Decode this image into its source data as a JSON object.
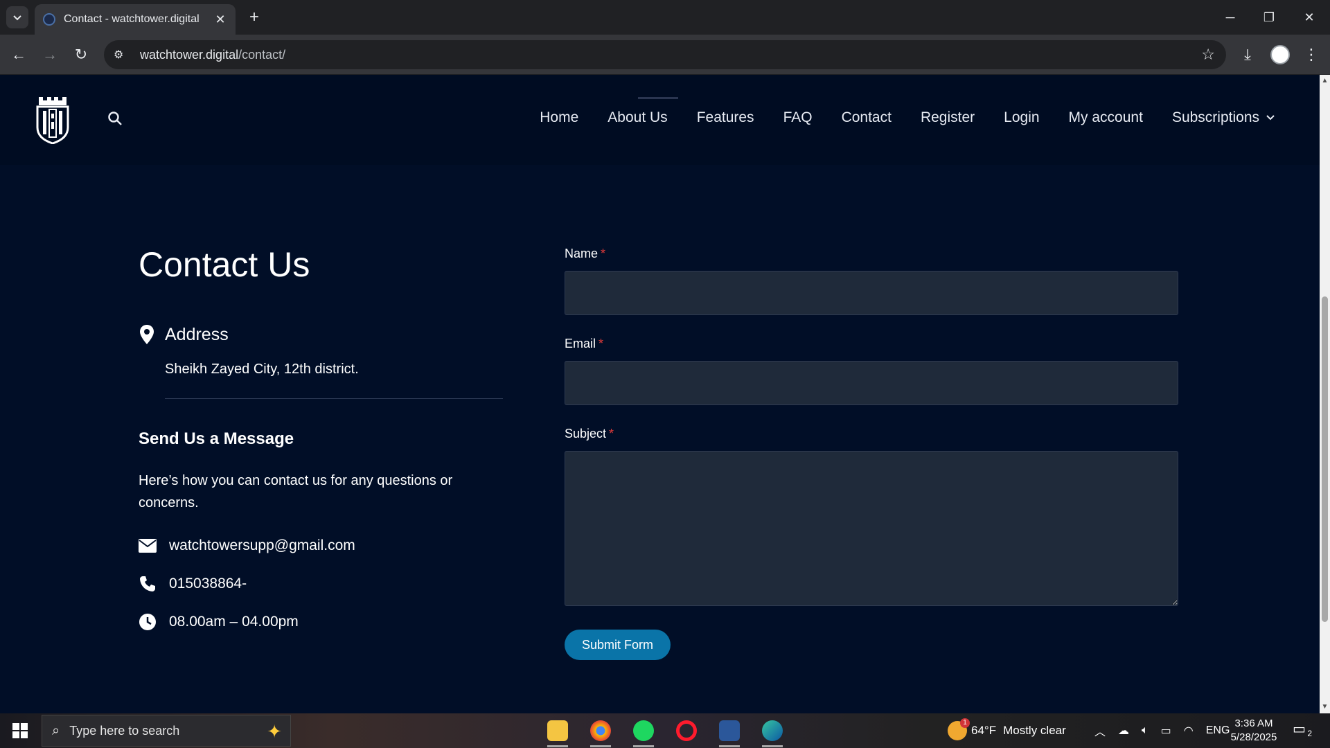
{
  "browser": {
    "tab_title": "Contact - watchtower.digital",
    "url_domain": "watchtower.digital",
    "url_path": "/contact/"
  },
  "nav": {
    "items": [
      "Home",
      "About Us",
      "Features",
      "FAQ",
      "Contact",
      "Register",
      "Login",
      "My account",
      "Subscriptions"
    ]
  },
  "contact": {
    "title": "Contact Us",
    "address_label": "Address",
    "address_text": "Sheikh Zayed City, 12th district.",
    "send_title": "Send Us a Message",
    "send_desc": "Here’s how you can contact us for any questions or concerns.",
    "email": "watchtowersupp@gmail.com",
    "phone": "015038864-",
    "hours": "08.00am – 04.00pm"
  },
  "form": {
    "name_label": "Name",
    "email_label": "Email",
    "subject_label": "Subject",
    "required_mark": "*",
    "submit_label": "Submit Form"
  },
  "taskbar": {
    "search_placeholder": "Type here to search",
    "weather_temp": "64°F",
    "weather_desc": "Mostly clear",
    "language": "ENG",
    "time": "3:36 AM",
    "date": "5/28/2025",
    "notification_count": "2",
    "weather_badge": "1"
  },
  "colors": {
    "page_bg": "#010e27",
    "header_bg": "#000c22",
    "input_bg": "#1f2a3a",
    "accent": "#0a74a8",
    "required": "#e03a3a"
  }
}
